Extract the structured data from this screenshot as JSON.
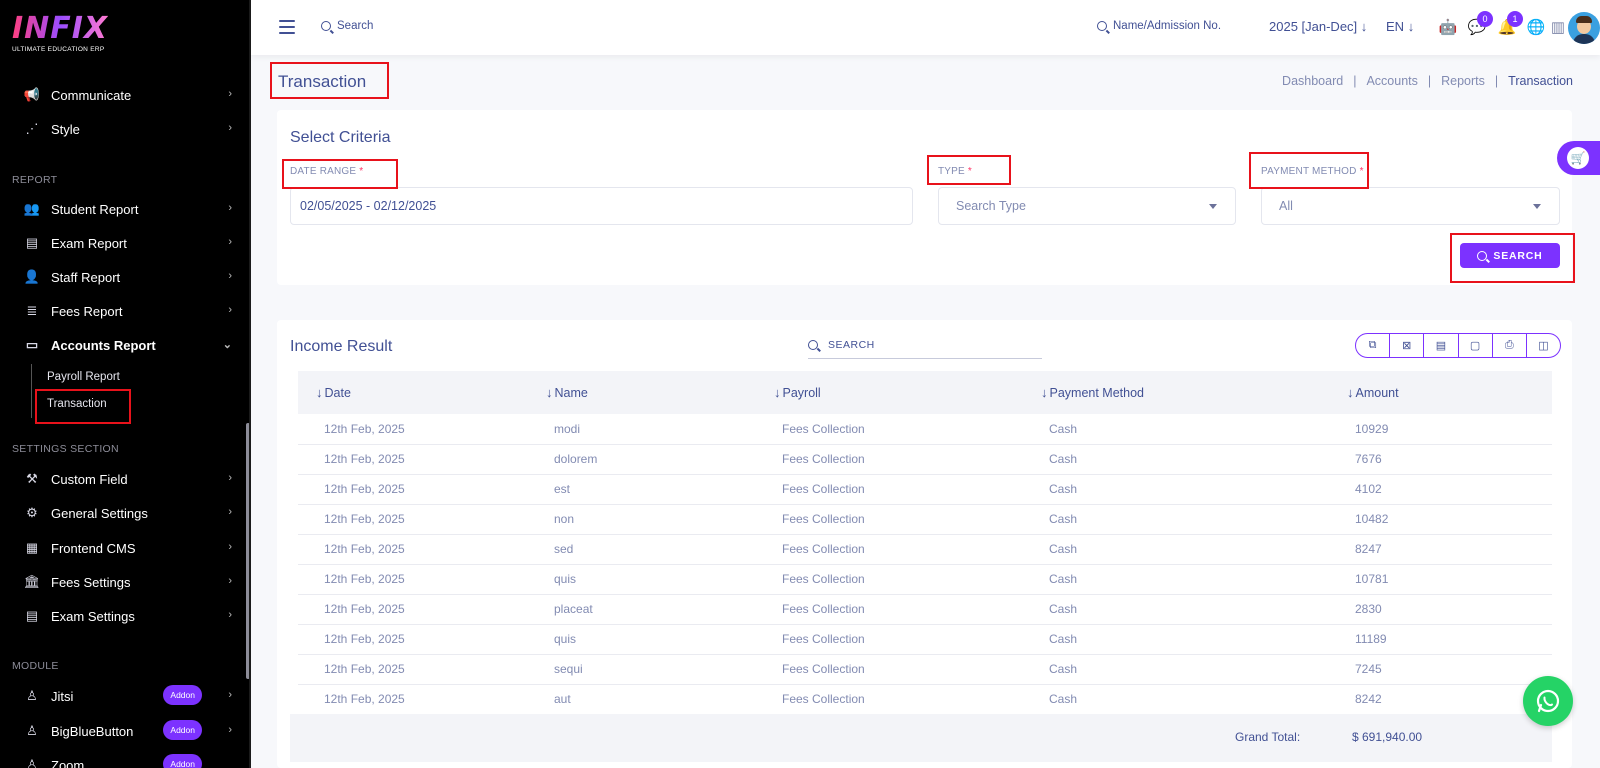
{
  "brand": {
    "name": "INFIX",
    "tagline": "ULTIMATE EDUCATION ERP",
    "accent": "#7c32ff"
  },
  "sidebar": {
    "top_items": [
      {
        "label": "Communicate",
        "icon": "megaphone-icon"
      },
      {
        "label": "Style",
        "icon": "style-icon"
      }
    ],
    "report_section": "REPORT",
    "report_items": [
      {
        "label": "Student Report",
        "icon": "students-icon"
      },
      {
        "label": "Exam Report",
        "icon": "book-icon"
      },
      {
        "label": "Staff Report",
        "icon": "staff-icon"
      },
      {
        "label": "Fees Report",
        "icon": "server-icon"
      },
      {
        "label": "Accounts Report",
        "icon": "money-icon"
      }
    ],
    "accounts_sub": [
      "Payroll Report",
      "Transaction"
    ],
    "settings_section": "SETTINGS SECTION",
    "settings_items": [
      {
        "label": "Custom Field",
        "icon": "custom-field-icon"
      },
      {
        "label": "General Settings",
        "icon": "gears-icon"
      },
      {
        "label": "Frontend CMS",
        "icon": "cms-icon"
      },
      {
        "label": "Fees Settings",
        "icon": "fees-icon"
      },
      {
        "label": "Exam Settings",
        "icon": "exam-icon"
      }
    ],
    "module_section": "MODULE",
    "module_items": [
      {
        "label": "Jitsi",
        "badge": "Addon"
      },
      {
        "label": "BigBlueButton",
        "badge": "Addon"
      },
      {
        "label": "Zoom",
        "badge": "Addon"
      }
    ]
  },
  "topbar": {
    "search_label": "Search",
    "name_search_label": "Name/Admission No.",
    "year": "2025 [Jan-Dec]",
    "language": "EN",
    "chat_badge": "0",
    "notification_badge": "1"
  },
  "page": {
    "title": "Transaction",
    "breadcrumb": [
      "Dashboard",
      "Accounts",
      "Reports",
      "Transaction"
    ]
  },
  "criteria": {
    "title": "Select Criteria",
    "date_range_label": "DATE RANGE",
    "date_range_value": "02/05/2025 - 02/12/2025",
    "type_label": "TYPE",
    "type_placeholder": "Search Type",
    "payment_method_label": "PAYMENT METHOD",
    "payment_method_value": "All",
    "required_mark": "*",
    "search_button": "SEARCH"
  },
  "result": {
    "title": "Income Result",
    "search_placeholder": "SEARCH",
    "columns": [
      "Date",
      "Name",
      "Payroll",
      "Payment Method",
      "Amount"
    ],
    "rows": [
      [
        "12th Feb, 2025",
        "modi",
        "Fees Collection",
        "Cash",
        "10929"
      ],
      [
        "12th Feb, 2025",
        "dolorem",
        "Fees Collection",
        "Cash",
        "7676"
      ],
      [
        "12th Feb, 2025",
        "est",
        "Fees Collection",
        "Cash",
        "4102"
      ],
      [
        "12th Feb, 2025",
        "non",
        "Fees Collection",
        "Cash",
        "10482"
      ],
      [
        "12th Feb, 2025",
        "sed",
        "Fees Collection",
        "Cash",
        "8247"
      ],
      [
        "12th Feb, 2025",
        "quis",
        "Fees Collection",
        "Cash",
        "10781"
      ],
      [
        "12th Feb, 2025",
        "placeat",
        "Fees Collection",
        "Cash",
        "2830"
      ],
      [
        "12th Feb, 2025",
        "quis",
        "Fees Collection",
        "Cash",
        "11189"
      ],
      [
        "12th Feb, 2025",
        "sequi",
        "Fees Collection",
        "Cash",
        "7245"
      ],
      [
        "12th Feb, 2025",
        "aut",
        "Fees Collection",
        "Cash",
        "8242"
      ]
    ],
    "grand_total_label": "Grand Total:",
    "grand_total_value": "$ 691,940.00"
  }
}
